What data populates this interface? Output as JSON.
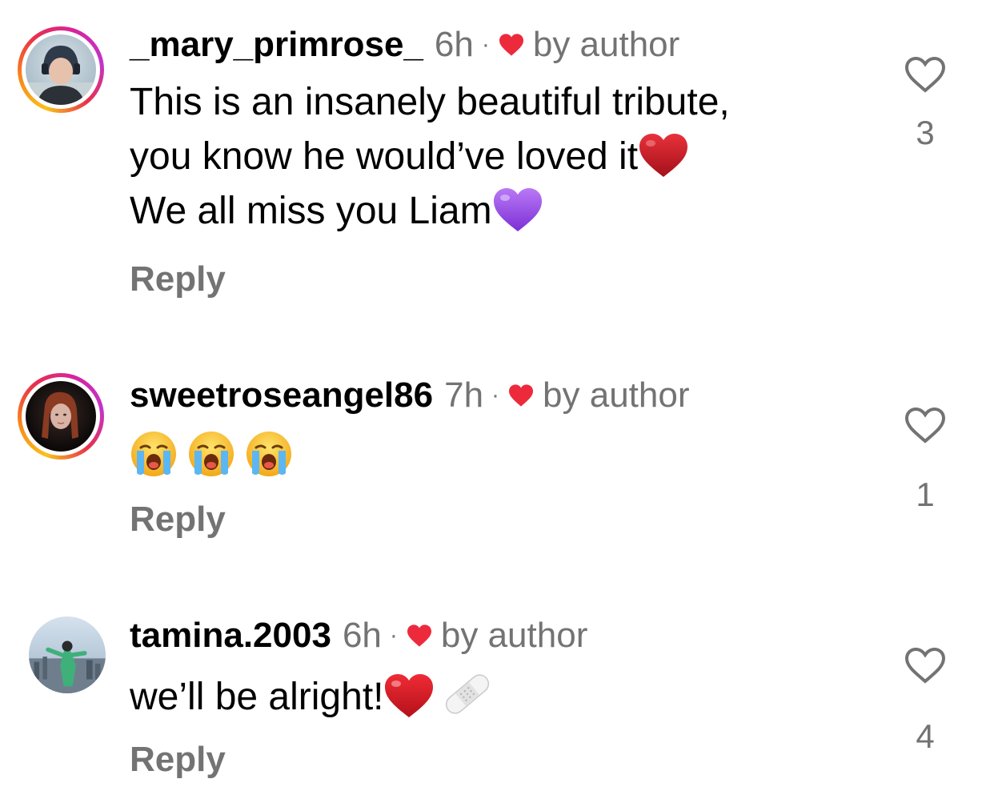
{
  "comments": [
    {
      "username": "_mary_primrose_",
      "time": "6h",
      "separator": "·",
      "by_author": "by author",
      "lines": [
        {
          "text": "This is an insanely beautiful tribute,"
        },
        {
          "text": "you know he would’ve loved it",
          "emoji": "red-heart"
        },
        {
          "text": "We all miss you Liam",
          "emoji": "purple-heart"
        }
      ],
      "reply_label": "Reply",
      "like_count": "3",
      "has_story_ring": true
    },
    {
      "username": "sweetroseangel86",
      "time": "7h",
      "separator": "·",
      "by_author": "by author",
      "emoji_row": [
        "loudly-crying-face",
        "loudly-crying-face",
        "loudly-crying-face"
      ],
      "reply_label": "Reply",
      "like_count": "1",
      "has_story_ring": true
    },
    {
      "username": "tamina.2003",
      "time": "6h",
      "separator": "·",
      "by_author": "by author",
      "lines": [
        {
          "text": "we’ll be alright!",
          "emoji": "red-heart,adhesive-bandage"
        }
      ],
      "reply_label": "Reply",
      "like_count": "4",
      "has_story_ring": false
    }
  ],
  "colors": {
    "secondary_text": "#737373",
    "primary_text": "#000000",
    "author_heart": "#ed2a3c",
    "story_ring_start": "#f9c21b",
    "story_ring_end": "#d6249f"
  }
}
